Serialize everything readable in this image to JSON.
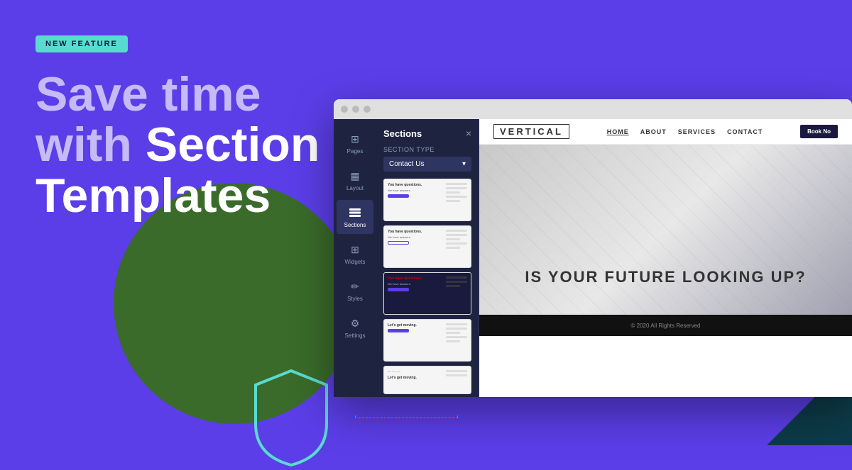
{
  "background": {
    "color": "#5B3EE8"
  },
  "badge": {
    "label": "NEW FEATURE"
  },
  "heading": {
    "line1_light": "Save time",
    "line2_light": "with ",
    "line2_bold": "Section",
    "line3": "Templates"
  },
  "builder": {
    "panel_title": "Sections",
    "section_type_label": "Section Type",
    "section_type_value": "Contact Us",
    "close_icon": "×",
    "sidebar_items": [
      {
        "label": "Pages",
        "icon": "⊞"
      },
      {
        "label": "Layout",
        "icon": "▦"
      },
      {
        "label": "Sections",
        "icon": "≡",
        "active": true
      },
      {
        "label": "Widgets",
        "icon": "⊞"
      },
      {
        "label": "Styles",
        "icon": "✏"
      },
      {
        "label": "Settings",
        "icon": "⚙"
      }
    ],
    "templates": [
      {
        "style": "light",
        "title": "You have questions.",
        "subtitle": "We have answers.",
        "btn": "filled"
      },
      {
        "style": "light-outline",
        "title": "You have questions.",
        "subtitle": "We have answers.",
        "btn": "outline"
      },
      {
        "style": "dark",
        "title": "You have questions.",
        "subtitle": "We have answers.",
        "btn": "filled"
      },
      {
        "style": "light-form",
        "title": "Let's get moving.",
        "btn": "filled"
      },
      {
        "style": "light-form2",
        "title": "Let's get moving.",
        "btn": "filled"
      }
    ]
  },
  "website": {
    "logo": "VERTICAL",
    "nav_links": [
      "HOME",
      "ABOUT",
      "SERVICES",
      "CONTACT"
    ],
    "cta_label": "Book No",
    "hero_text": "IS YOUR FUTURE  LOOKING UP?",
    "footer_text": "© 2020 All Rights Reserved"
  }
}
